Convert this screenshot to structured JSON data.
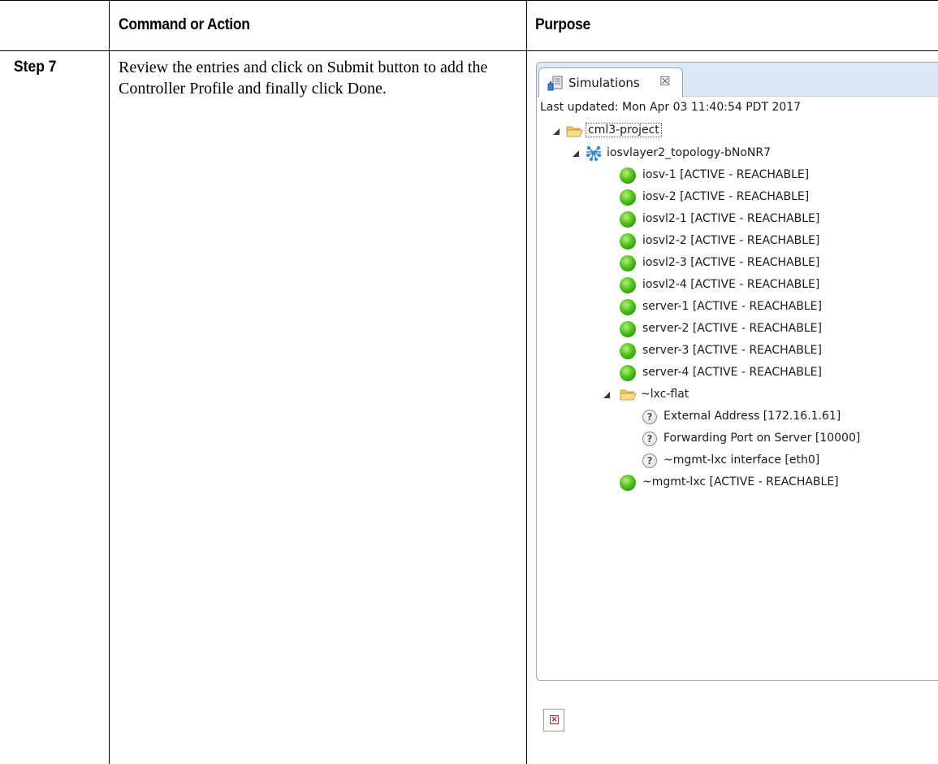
{
  "table": {
    "header": {
      "col1": "Command or Action",
      "col2": "Purpose"
    },
    "row": {
      "step": "Step 7",
      "description": " Review the entries and click on Submit button to add the Controller Profile and finally click Done."
    }
  },
  "panel": {
    "tab_label": "Simulations",
    "tab_close_icon": "close-icon",
    "last_updated": "Last updated: Mon Apr 03 11:40:54 PDT 2017",
    "project": "cml3-project",
    "topology": "iosvlayer2_topology-bNoNR7",
    "nodes": [
      "iosv-1  [ACTIVE - REACHABLE]",
      "iosv-2  [ACTIVE - REACHABLE]",
      "iosvl2-1  [ACTIVE - REACHABLE]",
      "iosvl2-2  [ACTIVE - REACHABLE]",
      "iosvl2-3  [ACTIVE - REACHABLE]",
      "iosvl2-4  [ACTIVE - REACHABLE]",
      "server-1  [ACTIVE - REACHABLE]",
      "server-2  [ACTIVE - REACHABLE]",
      "server-3  [ACTIVE - REACHABLE]",
      "server-4  [ACTIVE - REACHABLE]"
    ],
    "lxc_folder": "~lxc-flat",
    "lxc_items": [
      "External Address  [172.16.1.61]",
      "Forwarding Port on Server  [10000]",
      "~mgmt-lxc interface  [eth0]"
    ],
    "mgmt_node": "~mgmt-lxc  [ACTIVE - REACHABLE]",
    "question_glyph": "?"
  },
  "colors": {
    "status_active": "#4fc21d",
    "panel_header": "#dde8f6"
  }
}
